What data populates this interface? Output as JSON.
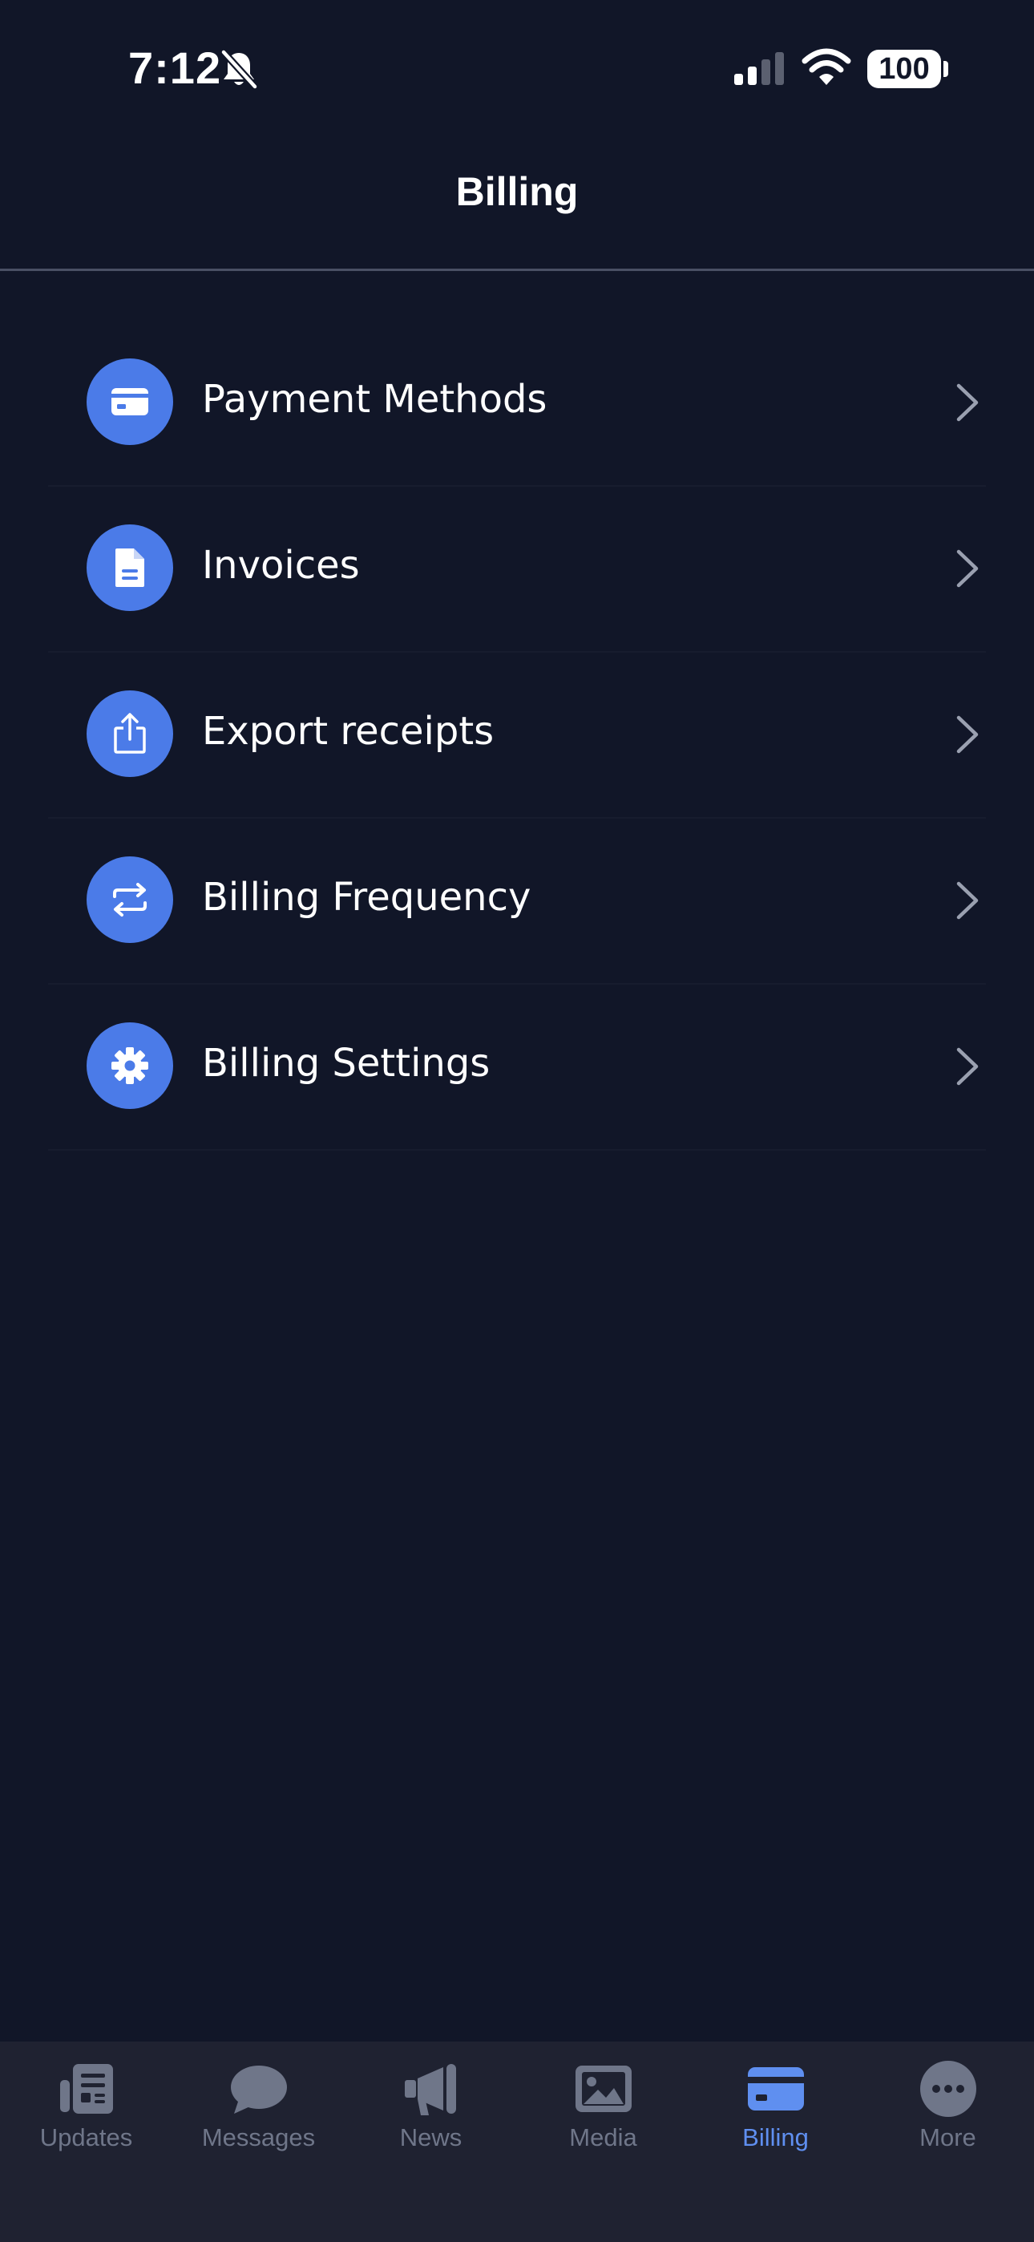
{
  "status_bar": {
    "time": "7:12",
    "battery": "100"
  },
  "header": {
    "title": "Billing"
  },
  "menu": {
    "items": [
      {
        "label": "Payment Methods",
        "icon": "credit-card-icon"
      },
      {
        "label": "Invoices",
        "icon": "document-icon"
      },
      {
        "label": "Export receipts",
        "icon": "share-icon"
      },
      {
        "label": "Billing Frequency",
        "icon": "repeat-icon"
      },
      {
        "label": "Billing Settings",
        "icon": "gear-icon"
      }
    ]
  },
  "tab_bar": {
    "active": "Billing",
    "tabs": [
      {
        "label": "Updates",
        "icon": "newspaper-icon"
      },
      {
        "label": "Messages",
        "icon": "chat-bubble-icon"
      },
      {
        "label": "News",
        "icon": "megaphone-icon"
      },
      {
        "label": "Media",
        "icon": "image-icon"
      },
      {
        "label": "Billing",
        "icon": "credit-card-icon"
      },
      {
        "label": "More",
        "icon": "more-dots-icon"
      }
    ]
  },
  "colors": {
    "background": "#111628",
    "accent": "#4b7be8",
    "tab_active": "#5f8ff0",
    "tab_inactive": "#6f7689",
    "tab_bar_bg": "#1f2231"
  }
}
